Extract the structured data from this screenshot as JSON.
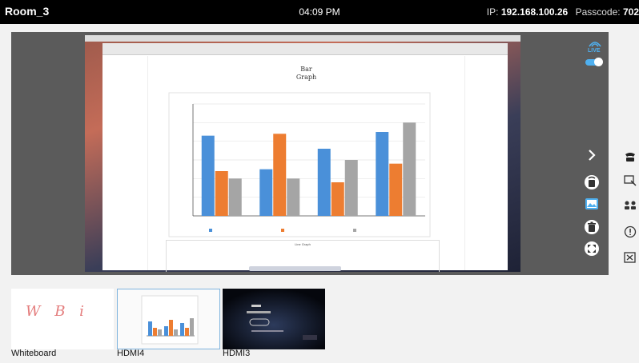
{
  "header": {
    "room": "Room_3",
    "time": "04:09 PM",
    "ip_label": "IP:",
    "ip_value": "192.168.100.26",
    "passcode_label": "Passcode:",
    "passcode_value": "702"
  },
  "preview": {
    "live_label": "LIVE",
    "live_on": true,
    "chart": {
      "title_line1": "Bar",
      "title_line2": "Graph",
      "subchart_title": "Line Graph"
    }
  },
  "chart_data": {
    "type": "bar",
    "title": "Bar Graph",
    "categories": [
      "",
      "",
      "",
      ""
    ],
    "series": [
      {
        "color": "#4a90d9",
        "values": [
          4.3,
          2.5,
          3.6,
          4.5
        ]
      },
      {
        "color": "#ed7d31",
        "values": [
          2.4,
          4.4,
          1.8,
          2.8
        ]
      },
      {
        "color": "#a5a5a5",
        "values": [
          2.0,
          2.0,
          3.0,
          5.0
        ]
      }
    ],
    "ylim": [
      0,
      6
    ]
  },
  "thumbnails": [
    {
      "label": "Whiteboard",
      "content": "W B i"
    },
    {
      "label": "HDMI4"
    },
    {
      "label": "HDMI3"
    }
  ],
  "colors": {
    "accent": "#4fb0f0",
    "topbar": "#000000",
    "preview_bg": "#5b5b5b"
  }
}
